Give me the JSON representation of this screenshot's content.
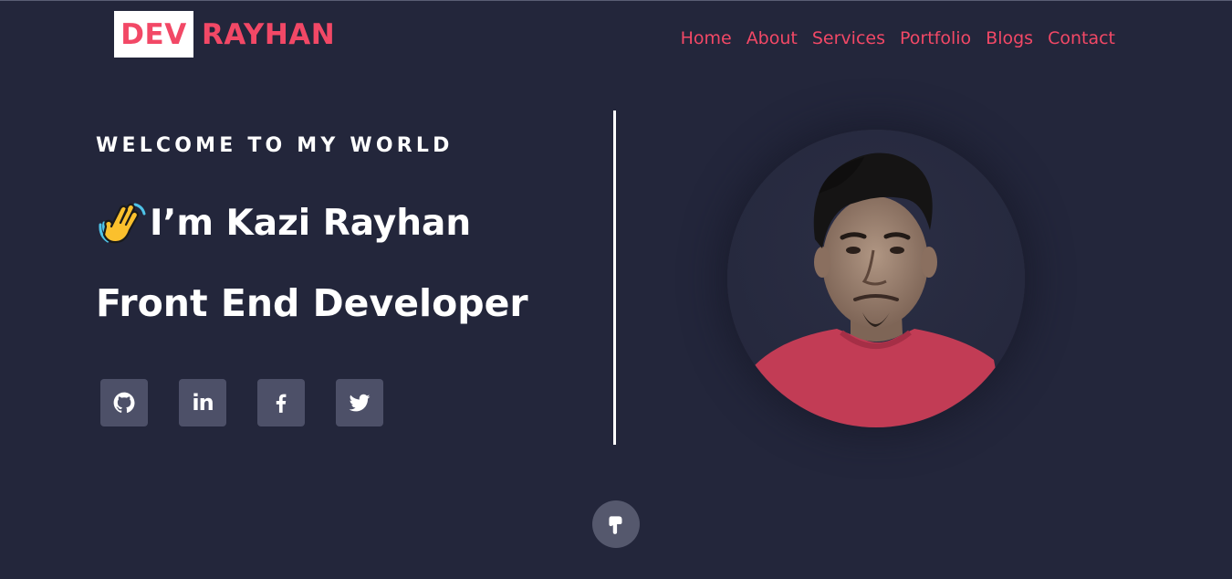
{
  "brand": {
    "badge": "DEV",
    "name": "RAYHAN",
    "accent_color": "#f24866",
    "background_color": "#23263b"
  },
  "nav": {
    "items": [
      {
        "label": "Home"
      },
      {
        "label": "About"
      },
      {
        "label": "Services"
      },
      {
        "label": "Portfolio"
      },
      {
        "label": "Blogs"
      },
      {
        "label": "Contact"
      }
    ]
  },
  "hero": {
    "welcome": "WELCOME TO MY WORLD",
    "greeting": "I’m Kazi Rayhan",
    "greeting_icon": "waving-hand-icon",
    "role": "Front End Developer"
  },
  "socials": [
    {
      "name": "github",
      "icon": "github-icon"
    },
    {
      "name": "linkedin",
      "icon": "linkedin-icon",
      "text": "in"
    },
    {
      "name": "facebook",
      "icon": "facebook-icon"
    },
    {
      "name": "twitter",
      "icon": "twitter-icon"
    }
  ],
  "scroll_down": {
    "icon": "pointing-down-hand-icon"
  }
}
